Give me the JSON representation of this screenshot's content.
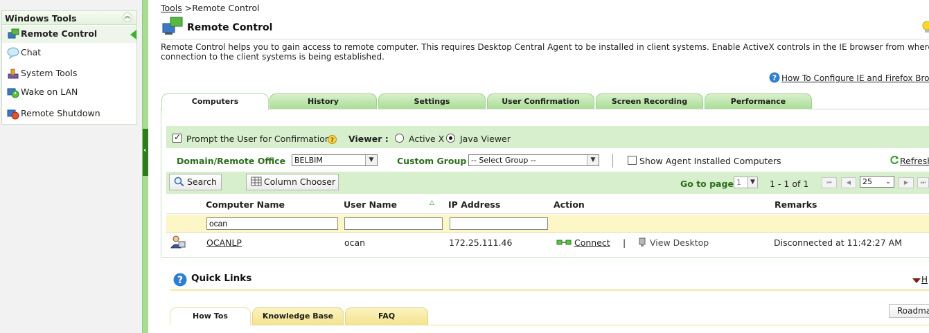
{
  "sidebar": {
    "title": "Windows Tools",
    "items": [
      {
        "label": "Remote Control",
        "icon": "remote-control-icon",
        "active": true
      },
      {
        "label": "Chat",
        "icon": "chat-icon"
      },
      {
        "label": "System Tools",
        "icon": "system-tools-icon"
      },
      {
        "label": "Wake on LAN",
        "icon": "wake-on-lan-icon"
      },
      {
        "label": "Remote Shutdown",
        "icon": "remote-shutdown-icon"
      }
    ]
  },
  "breadcrumb": {
    "link": "Tools",
    "separator": ">",
    "current": "Remote Control"
  },
  "page": {
    "title": "Remote Control",
    "description_line1": "Remote Control helps you to gain access to remote computer. This requires Desktop Central Agent to be installed in client systems. Enable ActiveX controls in the IE browser from where",
    "description_line2": "connection to the client systems is being established.",
    "help_link": "How To Configure IE and Firefox Bro"
  },
  "tabs": [
    {
      "label": "Computers",
      "active": true
    },
    {
      "label": "History"
    },
    {
      "label": "Settings"
    },
    {
      "label": "User Confirmation"
    },
    {
      "label": "Screen Recording"
    },
    {
      "label": "Performance"
    }
  ],
  "confirmation": {
    "prompt_label": "Prompt the User for Confirmation",
    "prompt_checked": true,
    "viewer_label": "Viewer :",
    "viewer_options": [
      "Active X",
      "Java Viewer"
    ],
    "viewer_selected": "Java Viewer"
  },
  "filters": {
    "domain_label": "Domain/Remote Office",
    "domain_value": "BELBIM",
    "group_label": "Custom Group",
    "group_value": "-- Select Group --",
    "show_agent_label": "Show Agent Installed Computers",
    "show_agent_checked": false,
    "refresh_label": "Refresh"
  },
  "toolbar": {
    "search_label": "Search",
    "column_chooser_label": "Column Chooser",
    "goto_label": "Go to page",
    "page_value": "1",
    "range_text": "1 - 1 of 1",
    "per_page": "25"
  },
  "table": {
    "columns": [
      "Computer Name",
      "User Name",
      "IP Address",
      "Action",
      "Remarks"
    ],
    "filter_values": {
      "computer": "ocan",
      "user": "",
      "ip": ""
    },
    "rows": [
      {
        "computer": "OCANLP",
        "user": "ocan",
        "ip": "172.25.111.46",
        "action_connect": "Connect",
        "action_separator": "|",
        "action_view": "View Desktop",
        "remarks": "Disconnected at 11:42:27 AM"
      }
    ]
  },
  "quick_links": {
    "title": "Quick Links",
    "hide_label": "H",
    "tabs": [
      "How Tos",
      "Knowledge Base",
      "FAQ"
    ],
    "active_tab": "How Tos",
    "roadmap_label": "Roadma"
  },
  "colors": {
    "accent_green": "#a9dc93",
    "panel_green": "#d7efcc",
    "label_green": "#2a6e1b",
    "filter_yellow": "#fdf6c6"
  }
}
